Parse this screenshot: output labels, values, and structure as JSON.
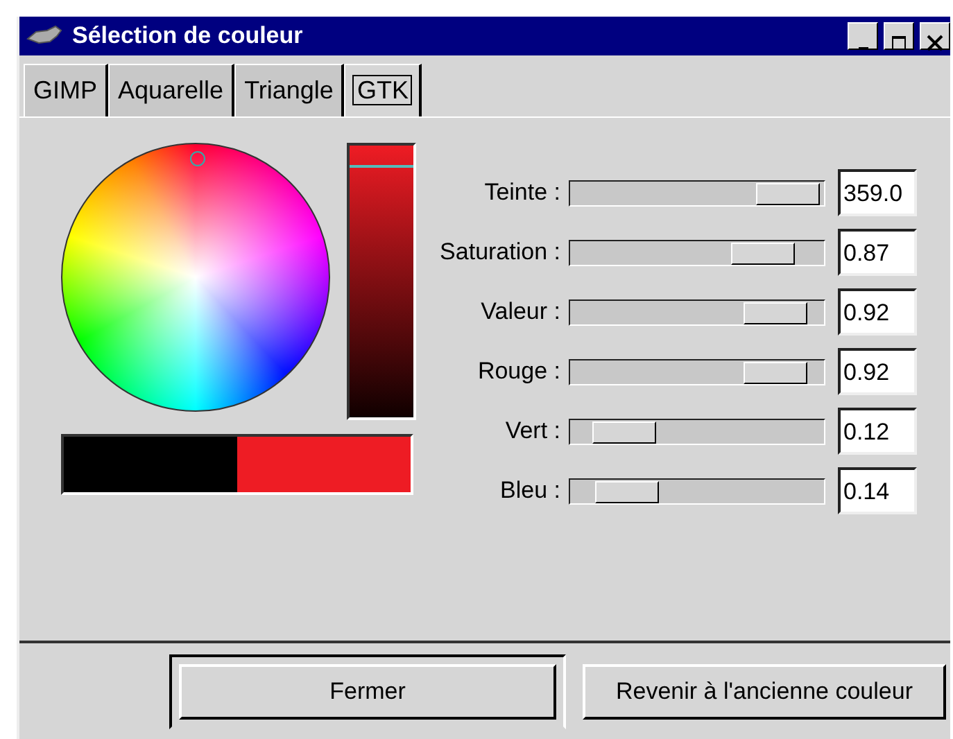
{
  "window": {
    "title": "Sélection de couleur"
  },
  "tabs": [
    {
      "label": "GIMP",
      "selected": false
    },
    {
      "label": "Aquarelle",
      "selected": false
    },
    {
      "label": "Triangle",
      "selected": false
    },
    {
      "label": "GTK",
      "selected": true
    }
  ],
  "swatches": [
    {
      "color": "#000000"
    },
    {
      "color": "#ee1c24"
    }
  ],
  "channels": [
    {
      "name": "Teinte :",
      "level": 0.98,
      "reading": "359.0"
    },
    {
      "name": "Saturation :",
      "level": 0.85,
      "reading": "0.87"
    },
    {
      "name": "Valeur :",
      "level": 0.91,
      "reading": "0.92"
    },
    {
      "name": "Rouge :",
      "level": 0.91,
      "reading": "0.92"
    },
    {
      "name": "Vert :",
      "level": 0.12,
      "reading": "0.12"
    },
    {
      "name": "Bleu :",
      "level": 0.13,
      "reading": "0.14"
    }
  ],
  "buttons": [
    {
      "label": "Fermer",
      "default": true
    },
    {
      "label": "Revenir à l'ancienne couleur",
      "default": false
    }
  ]
}
